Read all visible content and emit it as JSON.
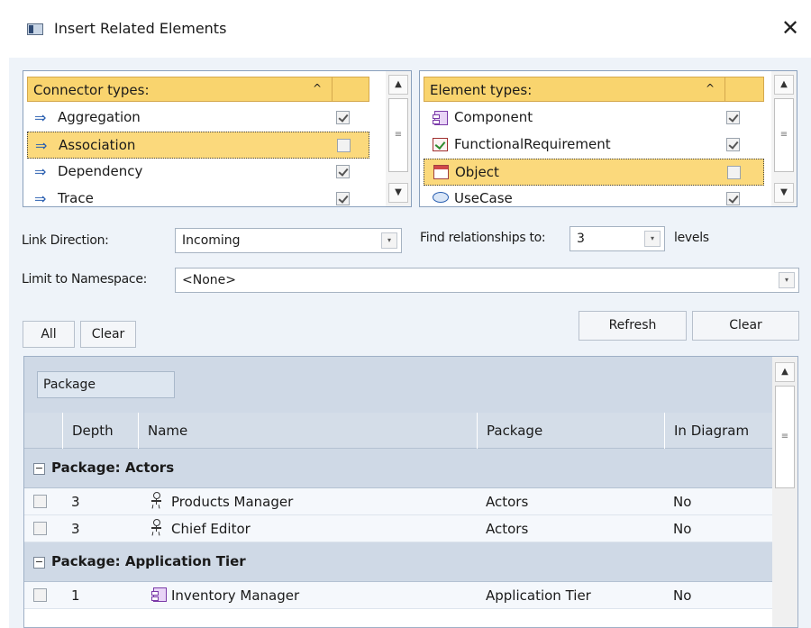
{
  "window": {
    "title": "Insert Related Elements",
    "close_glyph": "✕"
  },
  "connector_types": {
    "header": "Connector types:",
    "sort_glyph": "^",
    "items": [
      {
        "label": "Aggregation",
        "icon": "arrow-icon",
        "checked": true,
        "selected": false
      },
      {
        "label": "Association",
        "icon": "arrow-icon",
        "checked": false,
        "selected": true
      },
      {
        "label": "Dependency",
        "icon": "arrow-icon",
        "checked": true,
        "selected": false
      },
      {
        "label": "Trace",
        "icon": "arrow-icon",
        "checked": true,
        "selected": false
      }
    ]
  },
  "element_types": {
    "header": "Element types:",
    "sort_glyph": "^",
    "items": [
      {
        "label": "Component",
        "icon": "component-icon",
        "checked": true,
        "selected": false
      },
      {
        "label": "FunctionalRequirement",
        "icon": "requirement-icon",
        "checked": true,
        "selected": false
      },
      {
        "label": "Object",
        "icon": "object-icon",
        "checked": false,
        "selected": true
      },
      {
        "label": "UseCase",
        "icon": "usecase-icon",
        "checked": true,
        "selected": false
      }
    ]
  },
  "link_direction": {
    "label": "Link Direction:",
    "value": "Incoming"
  },
  "find_relationships": {
    "label": "Find relationships to:",
    "value": "3",
    "suffix": "levels"
  },
  "namespace": {
    "label": "Limit to Namespace:",
    "value": "<None>"
  },
  "buttons": {
    "all": "All",
    "clear_small": "Clear",
    "refresh": "Refresh",
    "clear": "Clear"
  },
  "grid": {
    "group_by_chip": "Package",
    "columns": [
      "Depth",
      "Name",
      "Package",
      "In Diagram"
    ],
    "groups": [
      {
        "title": "Package: Actors",
        "expander": "−",
        "rows": [
          {
            "depth": "3",
            "name": "Products Manager",
            "icon": "actor-icon",
            "package": "Actors",
            "in_diagram": "No"
          },
          {
            "depth": "3",
            "name": "Chief Editor",
            "icon": "actor-icon",
            "package": "Actors",
            "in_diagram": "No"
          }
        ]
      },
      {
        "title": "Package: Application Tier",
        "expander": "−",
        "rows": [
          {
            "depth": "1",
            "name": "Inventory Manager",
            "icon": "component-icon",
            "package": "Application Tier",
            "in_diagram": "No"
          }
        ]
      }
    ]
  },
  "scroll_glyphs": {
    "up": "▲",
    "down": "▼",
    "grip": "≡",
    "combo": "▾"
  },
  "colors": {
    "selection": "#fbd97c",
    "header_yellow": "#f9d46e",
    "dialog_bg": "#eef3f9",
    "grid_group": "#cfd9e6"
  }
}
